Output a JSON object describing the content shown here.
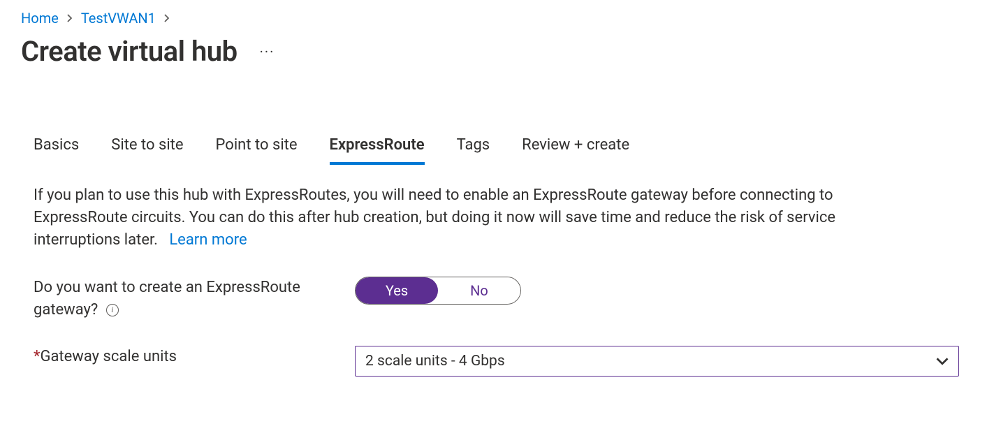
{
  "breadcrumb": {
    "items": [
      {
        "label": "Home"
      },
      {
        "label": "TestVWAN1"
      }
    ]
  },
  "page": {
    "title": "Create virtual hub"
  },
  "tabs": [
    {
      "label": "Basics",
      "active": false
    },
    {
      "label": "Site to site",
      "active": false
    },
    {
      "label": "Point to site",
      "active": false
    },
    {
      "label": "ExpressRoute",
      "active": true
    },
    {
      "label": "Tags",
      "active": false
    },
    {
      "label": "Review + create",
      "active": false
    }
  ],
  "description": {
    "text": "If you plan to use this hub with ExpressRoutes, you will need to enable an ExpressRoute gateway before connecting to ExpressRoute circuits. You can do this after hub creation, but doing it now will save time and reduce the risk of service interruptions later.",
    "learn_more": "Learn more"
  },
  "form": {
    "create_gateway": {
      "label": "Do you want to create an ExpressRoute gateway?",
      "yes": "Yes",
      "no": "No",
      "selected": "Yes"
    },
    "scale_units": {
      "label": "Gateway scale units",
      "required_marker": "*",
      "value": "2 scale units - 4 Gbps"
    }
  }
}
